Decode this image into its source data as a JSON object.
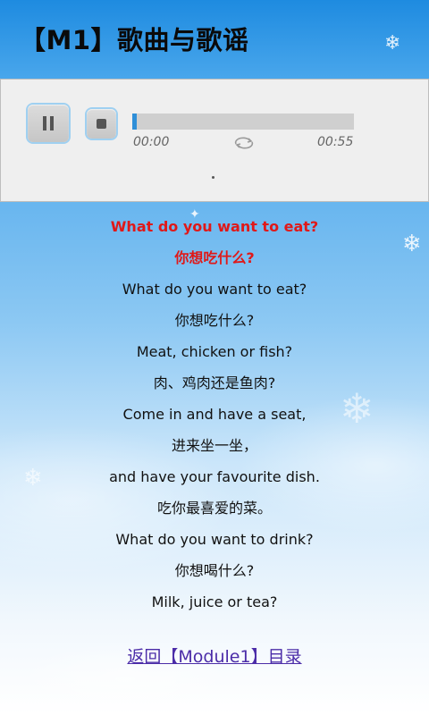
{
  "header": {
    "title": "【M1】歌曲与歌谣"
  },
  "player": {
    "current_time": "00:00",
    "total_time": "00:55",
    "progress": 0.02,
    "pause_icon": "pause-icon",
    "stop_icon": "stop-icon",
    "loop_icon": "repeat-icon",
    "status_dot": "."
  },
  "lyrics": [
    {
      "text": "What do you want to eat?",
      "highlight": true
    },
    {
      "text": "你想吃什么?",
      "highlight": true
    },
    {
      "text": "What do you want to eat?",
      "highlight": false
    },
    {
      "text": "你想吃什么?",
      "highlight": false
    },
    {
      "text": "Meat, chicken or fish?",
      "highlight": false
    },
    {
      "text": "肉、鸡肉还是鱼肉?",
      "highlight": false
    },
    {
      "text": "Come in and have a seat,",
      "highlight": false
    },
    {
      "text": "进来坐一坐，",
      "highlight": false
    },
    {
      "text": "and have your favourite dish.",
      "highlight": false
    },
    {
      "text": "吃你最喜爱的菜。",
      "highlight": false
    },
    {
      "text": "What do you want to drink?",
      "highlight": false
    },
    {
      "text": "你想喝什么?",
      "highlight": false
    },
    {
      "text": "Milk, juice or tea?",
      "highlight": false
    }
  ],
  "footer": {
    "back_link": "返回【Module1】目录"
  },
  "colors": {
    "highlight": "#e01818",
    "link": "#4b2ca8",
    "accent": "#2f8fd8"
  }
}
